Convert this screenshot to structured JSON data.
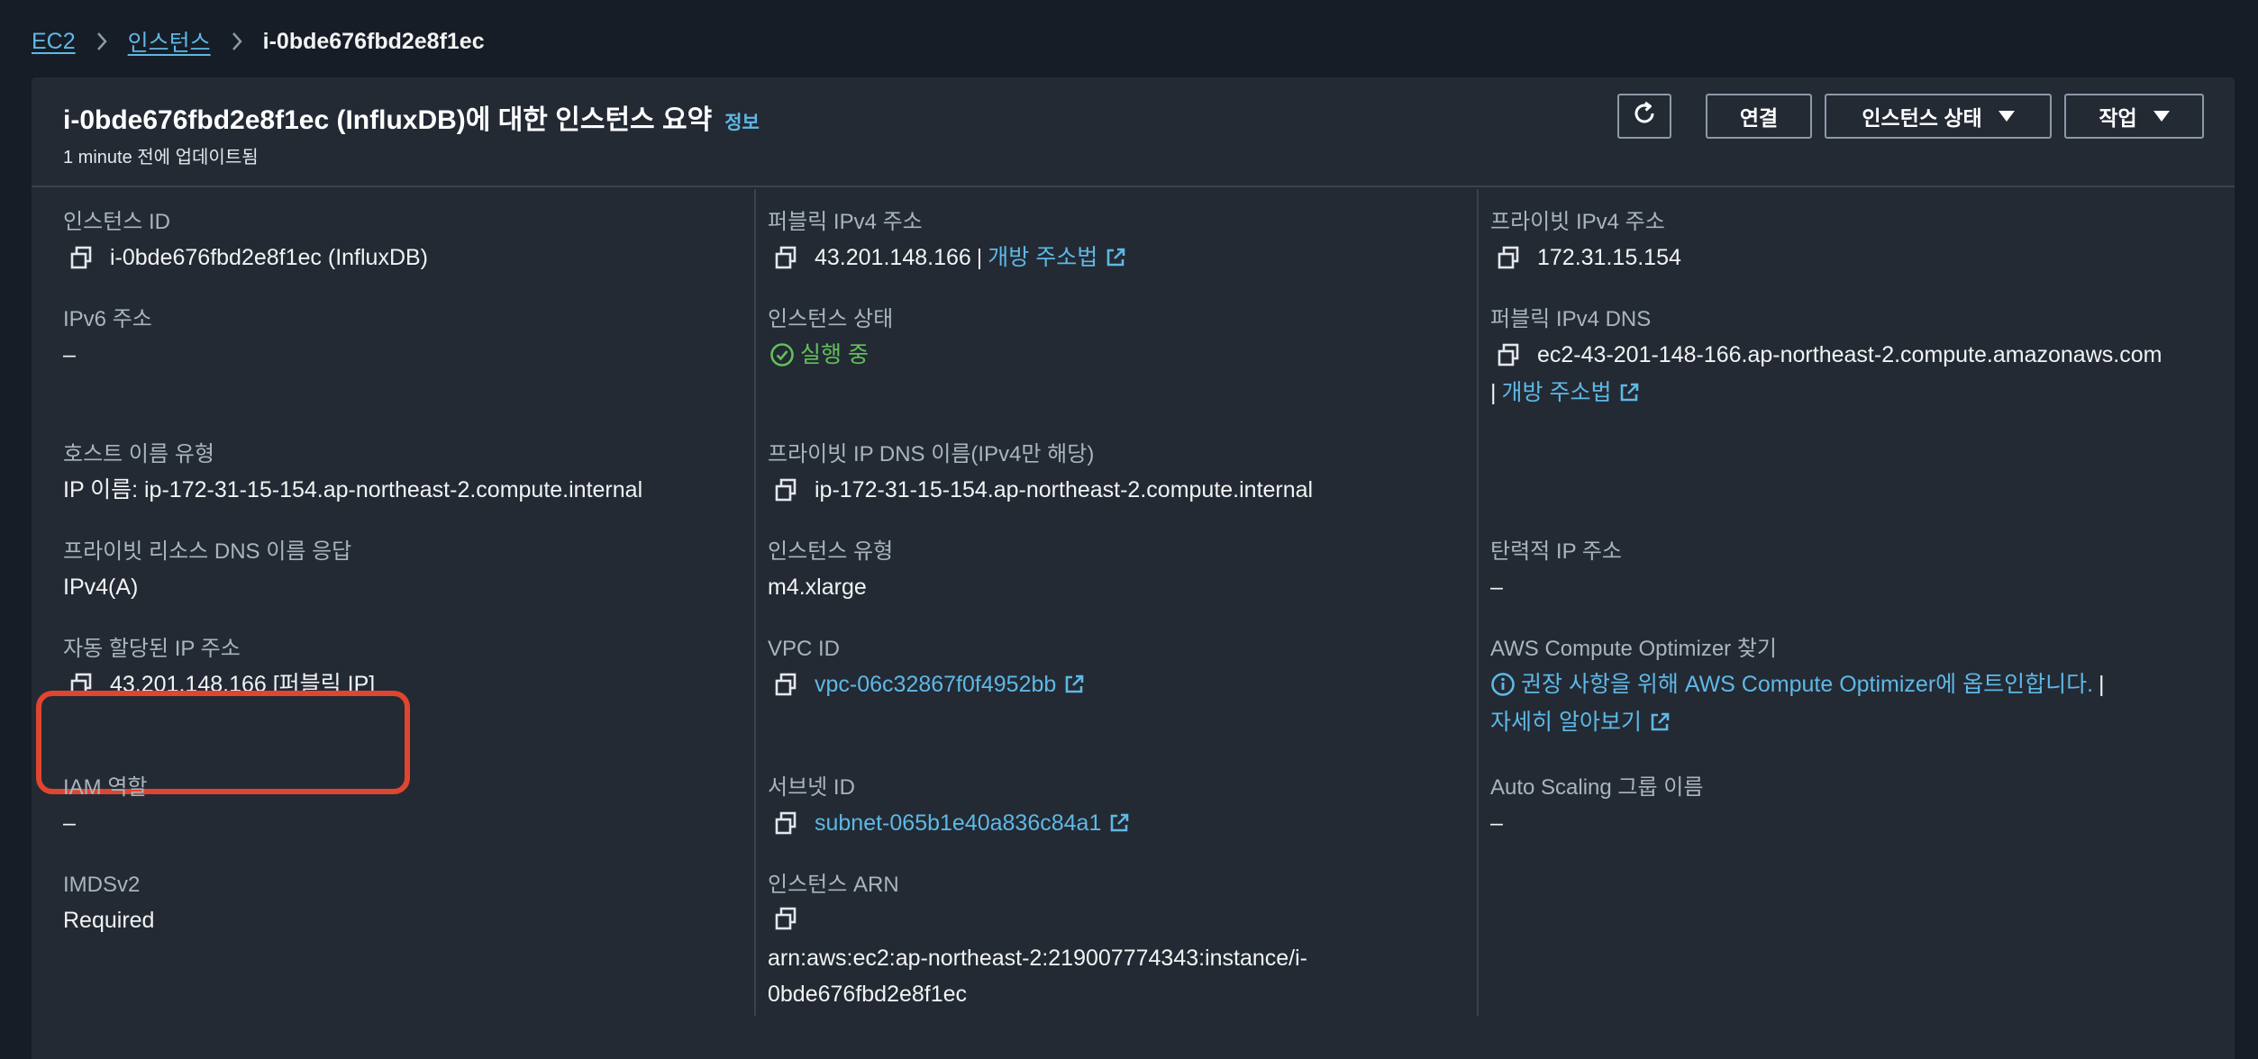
{
  "breadcrumb": {
    "items": [
      "EC2",
      "인스턴스"
    ],
    "current": "i-0bde676fbd2e8f1ec"
  },
  "header": {
    "title": "i-0bde676fbd2e8f1ec (InfluxDB)에 대한 인스턴스 요약",
    "info_label": "정보",
    "updated": "1 minute 전에 업데이트됨"
  },
  "actions": {
    "connect": "연결",
    "instance_state": "인스턴스 상태",
    "actions": "작업"
  },
  "fields": {
    "instance_id": {
      "label": "인스턴스 ID",
      "value": "i-0bde676fbd2e8f1ec (InfluxDB)"
    },
    "ipv6": {
      "label": "IPv6 주소",
      "value": "–"
    },
    "hostname_type": {
      "label": "호스트 이름 유형",
      "value": "IP 이름: ip-172-31-15-154.ap-northeast-2.compute.internal"
    },
    "private_dns_response": {
      "label": "프라이빗 리소스 DNS 이름 응답",
      "value": "IPv4(A)"
    },
    "auto_ip": {
      "label": "자동 할당된 IP 주소",
      "value": "43.201.148.166 [퍼블릭 IP]"
    },
    "iam_role": {
      "label": "IAM 역할",
      "value": "–"
    },
    "imdsv2": {
      "label": "IMDSv2",
      "value": "Required"
    },
    "public_ipv4": {
      "label": "퍼블릭 IPv4 주소",
      "value": "43.201.148.166",
      "link": "개방 주소법"
    },
    "instance_state": {
      "label": "인스턴스 상태",
      "value": "실행 중"
    },
    "private_ip_dns": {
      "label": "프라이빗 IP DNS 이름(IPv4만 해당)",
      "value": "ip-172-31-15-154.ap-northeast-2.compute.internal"
    },
    "instance_type": {
      "label": "인스턴스 유형",
      "value": "m4.xlarge"
    },
    "vpc_id": {
      "label": "VPC ID",
      "value": "vpc-06c32867f0f4952bb"
    },
    "subnet_id": {
      "label": "서브넷 ID",
      "value": "subnet-065b1e40a836c84a1"
    },
    "arn": {
      "label": "인스턴스 ARN",
      "value_line1": "arn:aws:ec2:ap-northeast-2:219007774343:instance/i-",
      "value_line2": "0bde676fbd2e8f1ec"
    },
    "private_ipv4": {
      "label": "프라이빗 IPv4 주소",
      "value": "172.31.15.154"
    },
    "public_dns": {
      "label": "퍼블릭 IPv4 DNS",
      "value": "ec2-43-201-148-166.ap-northeast-2.compute.amazonaws.com",
      "link": "개방 주소법"
    },
    "elastic_ip": {
      "label": "탄력적 IP 주소",
      "value": "–"
    },
    "optimizer": {
      "label": "AWS Compute Optimizer 찾기",
      "link": "권장 사항을 위해 AWS Compute Optimizer에 옵트인합니다.",
      "learn_more": "자세히 알아보기"
    },
    "asg_name": {
      "label": "Auto Scaling 그룹 이름",
      "value": "–"
    }
  },
  "colors": {
    "link": "#5fb8e6",
    "success": "#62c05a",
    "highlight": "#e0452f",
    "panel": "#232a34"
  }
}
